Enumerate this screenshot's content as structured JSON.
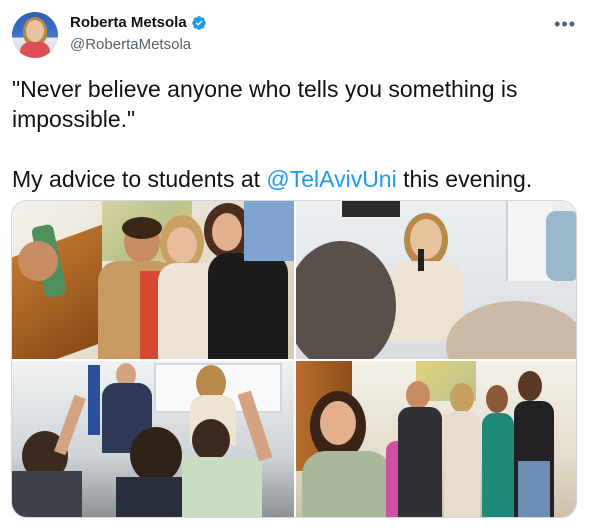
{
  "author": {
    "name": "Roberta Metsola",
    "handle": "@RobertaMetsola",
    "verified_icon": "verified-badge-icon"
  },
  "menu_icon": "more-options-icon",
  "tweet": {
    "line1": "\"Never believe anyone who tells you something is impossible.\"",
    "line2_prefix": "My advice to students at ",
    "line2_mention": "@TelAvivUni",
    "line2_suffix": " this evening."
  },
  "colors": {
    "text": "#0f1419",
    "secondary": "#536471",
    "accent": "#1d9bf0"
  }
}
